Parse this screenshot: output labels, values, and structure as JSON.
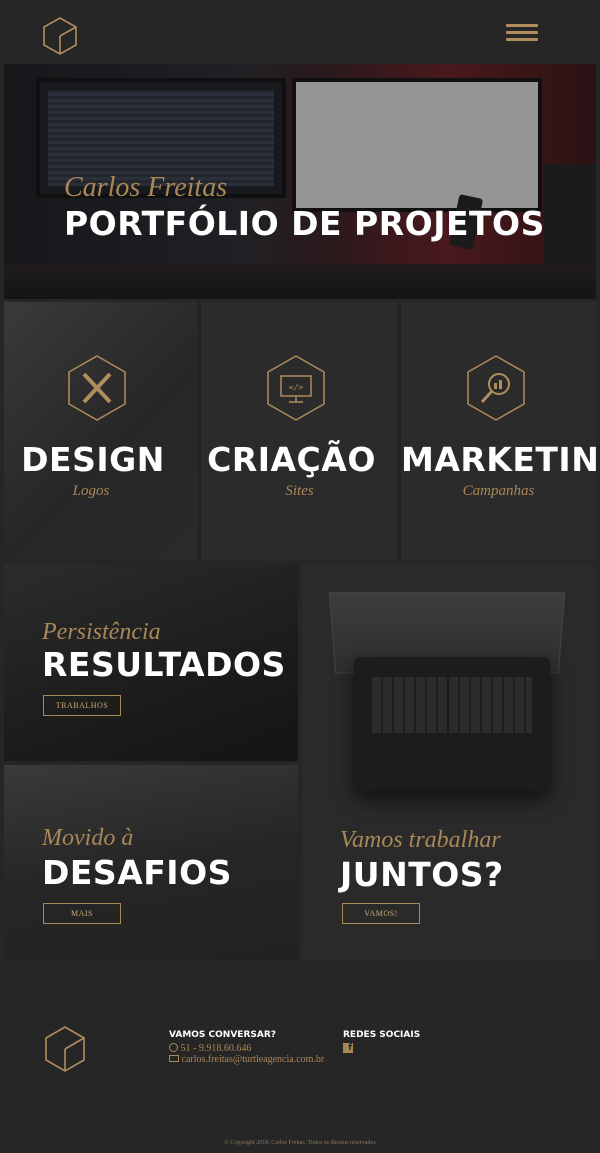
{
  "header": {
    "logo": "hexagon-logo",
    "menu": "hamburger-menu-icon"
  },
  "hero": {
    "subtitle": "Carlos Freitas",
    "title": "PORTFÓLIO DE PROJETOS"
  },
  "services": [
    {
      "title": "DESIGN",
      "subtitle": "Logos",
      "icon": "pencil-ruler-icon"
    },
    {
      "title": "CRIAÇÃO",
      "subtitle": "Sites",
      "icon": "code-monitor-icon"
    },
    {
      "title": "MARKETING",
      "subtitle": "Campanhas",
      "icon": "magnifier-chart-icon"
    }
  ],
  "panels": {
    "resultados": {
      "subtitle": "Persistência",
      "title": "RESULTADOS",
      "button": "TRABALHOS"
    },
    "desafios": {
      "subtitle": "Movido à",
      "title": "DESAFIOS",
      "button": "MAIS"
    },
    "juntos": {
      "subtitle": "Vamos trabalhar",
      "title": "JUNTOS?",
      "button": "VAMOS!"
    }
  },
  "footer": {
    "contact_heading": "VAMOS CONVERSAR?",
    "phone": "51 - 9.918.60.646",
    "email": "carlos.freitas@turtleagencia.com.br",
    "social_heading": "REDES SOCIAIS",
    "copyright": "© Copyright 2018. Carlos Freitas. Todos os direitos reservados"
  },
  "colors": {
    "accent": "#b08d5c",
    "background": "#262626",
    "text": "#ffffff"
  }
}
